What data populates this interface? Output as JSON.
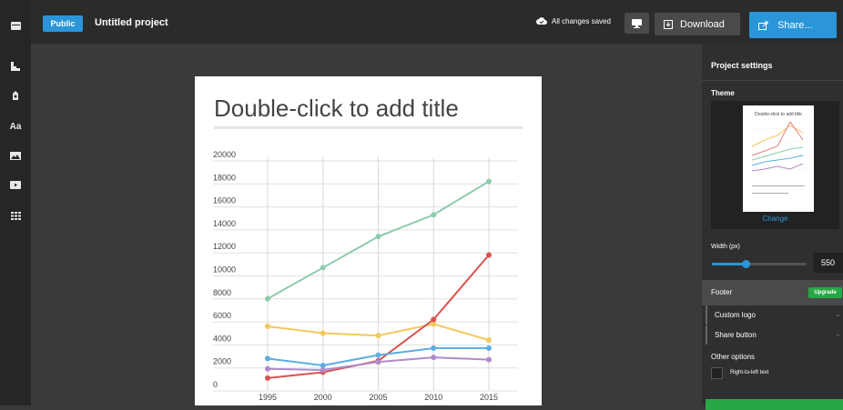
{
  "header": {
    "public_label": "Public",
    "project_title": "Untitled project",
    "save_status": "All changes saved",
    "download_label": "Download",
    "share_label": "Share..."
  },
  "left_toolbar": {
    "icons": [
      "chart-type-icon",
      "paint-bucket-icon",
      "text-font-icon",
      "image-icon",
      "video-icon",
      "grid-icon"
    ],
    "text_icon_label": "Aa"
  },
  "canvas": {
    "title_placeholder": "Double-click to add title"
  },
  "chart_data": {
    "type": "line",
    "title": "",
    "x": [
      1995,
      2000,
      2005,
      2010,
      2015
    ],
    "ylim": [
      0,
      20000
    ],
    "yticks": [
      "20000",
      "18000",
      "16000",
      "14000",
      "12000",
      "10000",
      "8000",
      "6000",
      "4000",
      "2000",
      "0"
    ],
    "grid": true,
    "series": [
      {
        "color": "#8dcbab",
        "values": [
          7700,
          10400,
          13100,
          15000,
          17900
        ]
      },
      {
        "color": "#f2c85e",
        "values": [
          5300,
          4700,
          4500,
          5500,
          4100
        ]
      },
      {
        "color": "#d9534f",
        "values": [
          800,
          1300,
          2300,
          5900,
          11500
        ]
      },
      {
        "color": "#5dade2",
        "values": [
          2500,
          1900,
          2800,
          3400,
          3400
        ]
      },
      {
        "color": "#b08bc9",
        "values": [
          1600,
          1500,
          2200,
          2600,
          2400
        ]
      }
    ]
  },
  "sidebar": {
    "heading": "Project settings",
    "theme_label": "Theme",
    "theme_thumb_title": "Double-click to add title",
    "change_link": "Change",
    "width_label": "Width (px)",
    "width_value": "550",
    "width_slider_fraction": 0.36,
    "footer_label": "Footer",
    "upgrade_label": "Upgrade",
    "custom_logo_label": "Custom logo",
    "share_button_label": "Share button",
    "other_options_label": "Other options",
    "rtl_label": "Right-to-left text"
  },
  "colors": {
    "accent": "#2a95d8",
    "upgrade_green": "#28a745"
  }
}
